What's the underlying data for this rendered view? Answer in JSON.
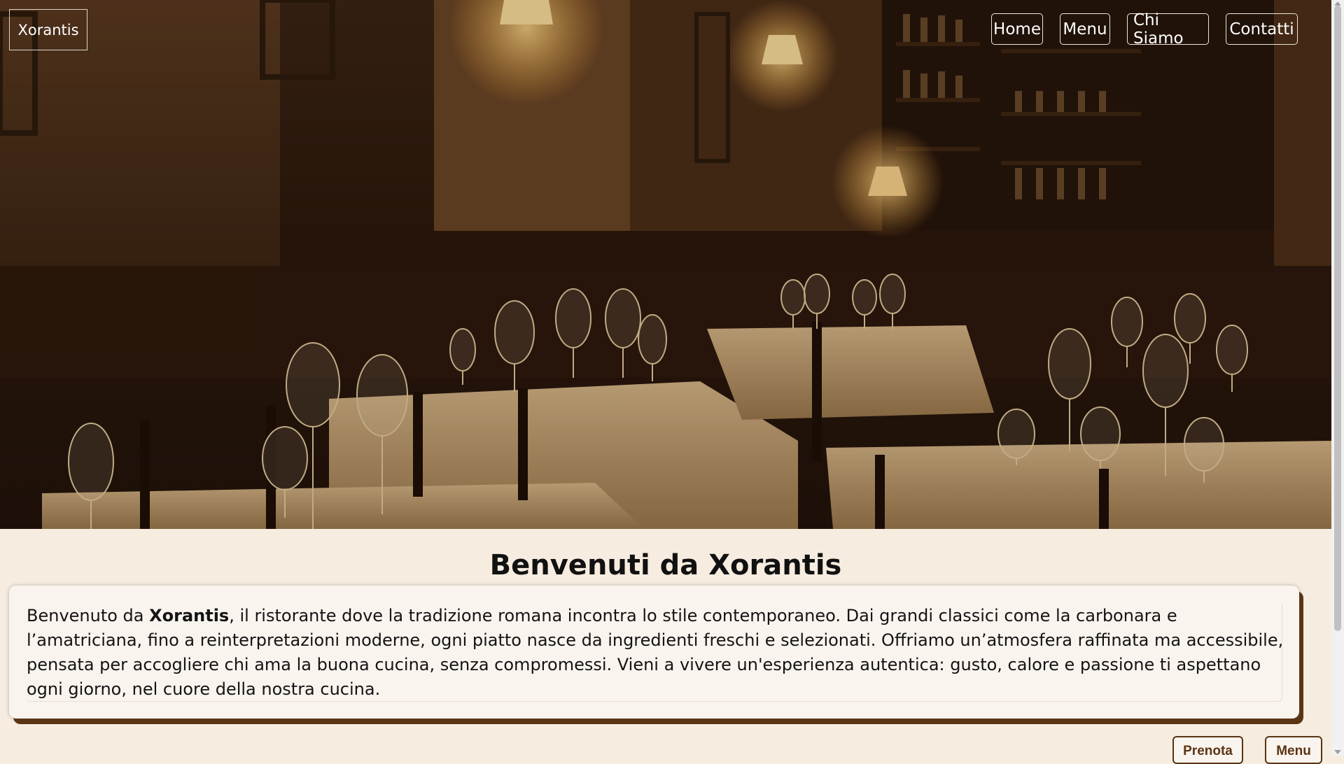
{
  "brand": {
    "logo_text": "Xorantis"
  },
  "nav": {
    "home": "Home",
    "menu": "Menu",
    "chi_siamo": "Chi Siamo",
    "contatti": "Contatti"
  },
  "hero": {
    "image_icon": "restaurant-interior-photo"
  },
  "main": {
    "title": "Benvenuti da Xorantis",
    "intro_prefix": "Benvenuto da ",
    "intro_bold": "Xorantis",
    "intro_rest": ", il ristorante dove la tradizione romana incontra lo stile contemporaneo. Dai grandi classici come la carbonara e l’amatriciana, fino a reinterpretazioni moderne, ogni piatto nasce da ingredienti freschi e selezionati. Offriamo un’atmosfera raffinata ma accessibile, pensata per accogliere chi ama la buona cucina, senza compromessi. Vieni a vivere un'esperienza autentica: gusto, calore e passione ti aspettano ogni giorno, nel cuore della nostra cucina."
  },
  "actions": {
    "prenota": "Prenota",
    "menu": "Menu"
  },
  "colors": {
    "accent": "#5a3414",
    "background": "#f6ece0"
  }
}
